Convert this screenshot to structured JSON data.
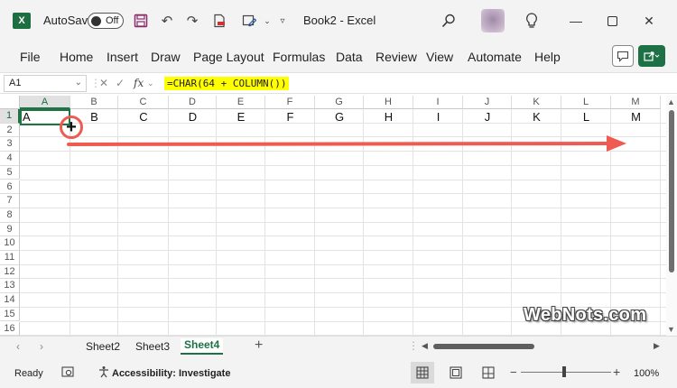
{
  "titlebar": {
    "app_icon_letter": "X",
    "autosave_label": "AutoSave",
    "autosave_state": "Off",
    "window_title": "Book2  -  Excel"
  },
  "menu": {
    "items": [
      "File",
      "Home",
      "Insert",
      "Draw",
      "Page Layout",
      "Formulas",
      "Data",
      "Review",
      "View",
      "Automate",
      "Help"
    ]
  },
  "formula_bar": {
    "name_box": "A1",
    "fx_label": "fx",
    "formula": "=CHAR(64 + COLUMN())"
  },
  "grid": {
    "columns": [
      "A",
      "B",
      "C",
      "D",
      "E",
      "F",
      "G",
      "H",
      "I",
      "J",
      "K",
      "L",
      "M"
    ],
    "rows": [
      "1",
      "2",
      "3",
      "4",
      "5",
      "6",
      "7",
      "8",
      "9",
      "10",
      "11",
      "12",
      "13",
      "14",
      "15",
      "16"
    ],
    "row1_values": [
      "A",
      "B",
      "C",
      "D",
      "E",
      "F",
      "G",
      "H",
      "I",
      "J",
      "K",
      "L",
      "M"
    ],
    "fill_handle_symbol": "+"
  },
  "watermark": "WebNots.com",
  "sheets": {
    "tabs": [
      "Sheet2",
      "Sheet3",
      "Sheet4"
    ],
    "active": "Sheet4",
    "add_symbol": "+"
  },
  "status": {
    "ready": "Ready",
    "accessibility": "Accessibility: Investigate",
    "zoom": "100%"
  },
  "colors": {
    "excel_green": "#217346",
    "annotation_red": "#ef5a51",
    "formula_highlight": "#ffff00"
  }
}
